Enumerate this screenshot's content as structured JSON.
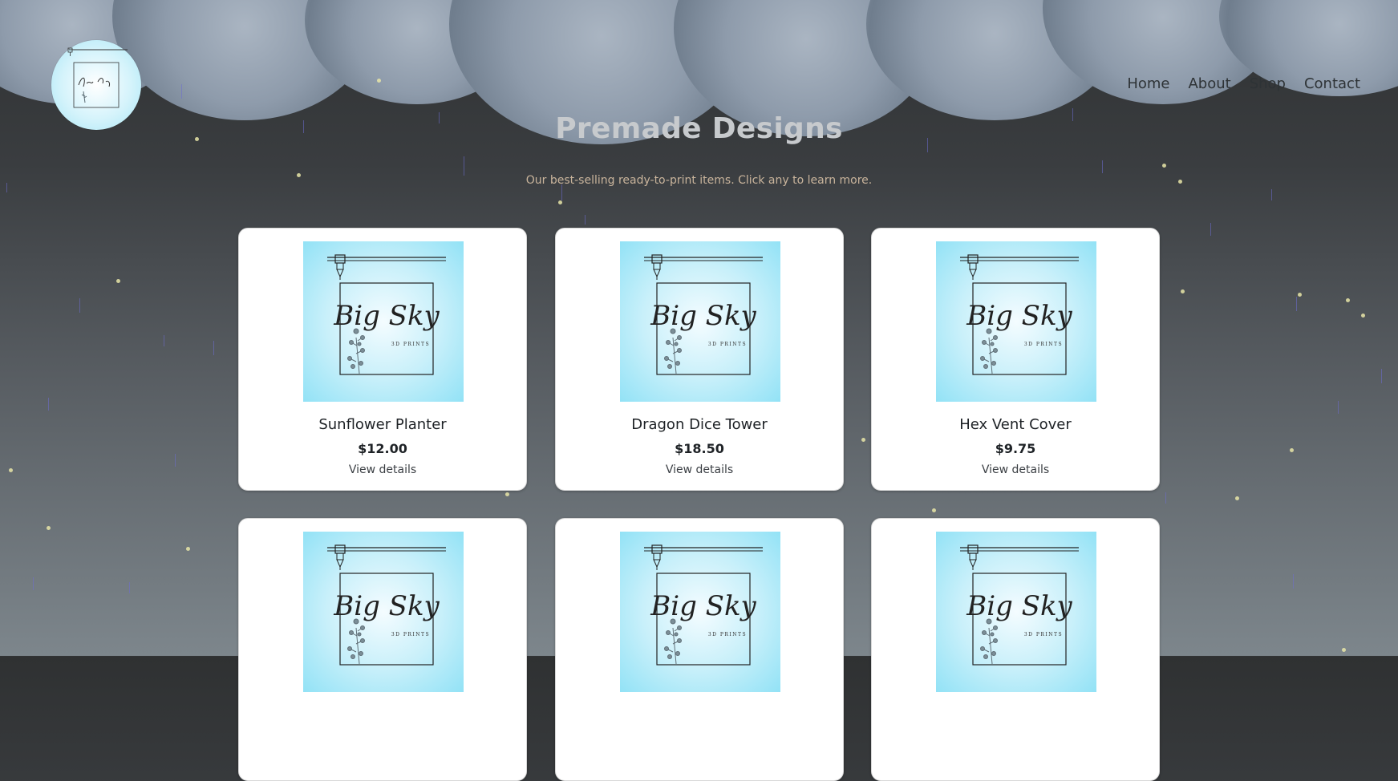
{
  "header": {
    "logo_alt": "Big Sky 3D Prints logo"
  },
  "nav": {
    "items": [
      "Home",
      "About",
      "Shop",
      "Contact"
    ]
  },
  "main": {
    "title": "Premade Designs",
    "subtitle": "Our best-selling ready-to-print items. Click any to learn more."
  },
  "products": [
    {
      "name": "Sunflower Planter",
      "price": "$12.00",
      "link": "View details"
    },
    {
      "name": "Dragon Dice Tower",
      "price": "$18.50",
      "link": "View details"
    },
    {
      "name": "Hex Vent Cover",
      "price": "$9.75",
      "link": "View details"
    },
    {
      "name": "",
      "price": "",
      "link": ""
    },
    {
      "name": "",
      "price": "",
      "link": ""
    },
    {
      "name": "",
      "price": "",
      "link": ""
    }
  ],
  "thumbnail": {
    "brand": "Big Sky",
    "tagline": "3D PRINTS"
  },
  "colors": {
    "accent_blue": "#92e2f6",
    "title_gray": "#c7cacd",
    "subtitle_tan": "#c9b49c"
  }
}
